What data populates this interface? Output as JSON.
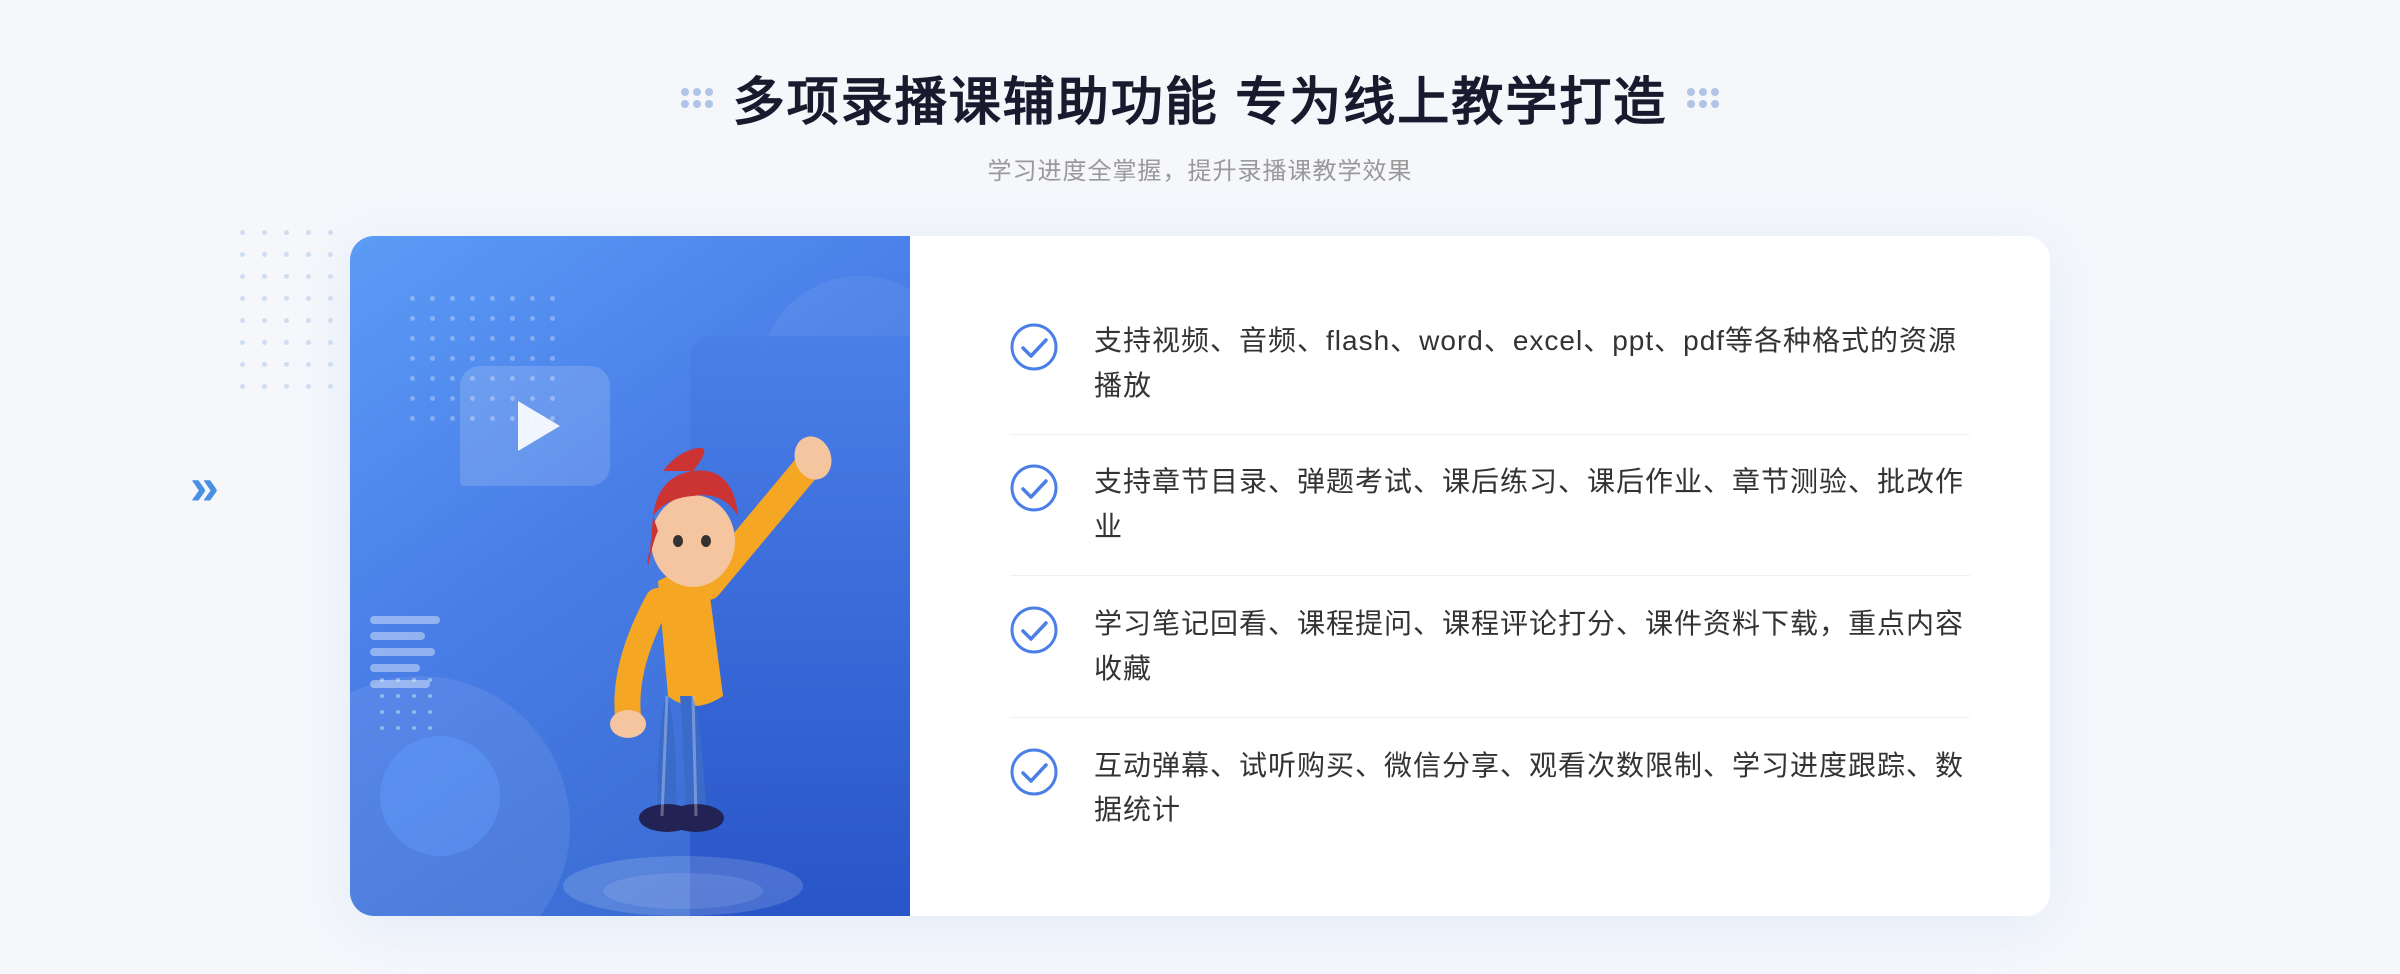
{
  "header": {
    "title": "多项录播课辅助功能 专为线上教学打造",
    "subtitle": "学习进度全掌握，提升录播课教学效果",
    "decorator_left": "decorators",
    "decorator_right": "decorators"
  },
  "features": [
    {
      "id": 1,
      "text": "支持视频、音频、flash、word、excel、ppt、pdf等各种格式的资源播放"
    },
    {
      "id": 2,
      "text": "支持章节目录、弹题考试、课后练习、课后作业、章节测验、批改作业"
    },
    {
      "id": 3,
      "text": "学习笔记回看、课程提问、课程评论打分、课件资料下载，重点内容收藏"
    },
    {
      "id": 4,
      "text": "互动弹幕、试听购买、微信分享、观看次数限制、学习进度跟踪、数据统计"
    }
  ],
  "colors": {
    "primary_blue": "#4a7fe8",
    "light_blue": "#5b9cf6",
    "dark_blue": "#2855c8",
    "text_dark": "#333333",
    "text_gray": "#999999",
    "check_blue": "#4a7fe8"
  },
  "icons": {
    "check": "check-circle-icon",
    "play": "play-icon",
    "chevron_left": "chevron-left-icon"
  }
}
